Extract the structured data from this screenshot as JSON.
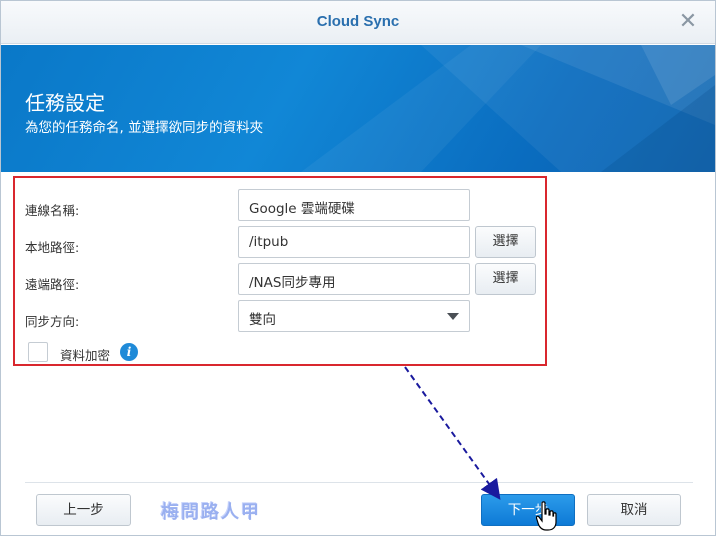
{
  "window": {
    "title": "Cloud Sync",
    "close_symbol": "✕"
  },
  "banner": {
    "title": "任務設定",
    "subtitle": "為您的任務命名, 並選擇欲同步的資料夾"
  },
  "form": {
    "connection_name": {
      "label": "連線名稱:",
      "value": "Google 雲端硬碟"
    },
    "local_path": {
      "label": "本地路徑:",
      "value": "/itpub",
      "button": "選擇"
    },
    "remote_path": {
      "label": "遠端路徑:",
      "value": "/NAS同步專用",
      "button": "選擇"
    },
    "sync_direction": {
      "label": "同步方向:",
      "value": "雙向"
    },
    "encrypt": {
      "label": "資料加密",
      "checked": false,
      "info_symbol": "i"
    }
  },
  "footer": {
    "back_label": "上一步",
    "next_label": "下一步",
    "cancel_label": "取消",
    "watermark": "梅問路人甲"
  },
  "colors": {
    "accent": "#0e7ad6",
    "banner": "#0a78c8",
    "highlight_border": "#d9272e",
    "arrow": "#1a1a9e"
  }
}
